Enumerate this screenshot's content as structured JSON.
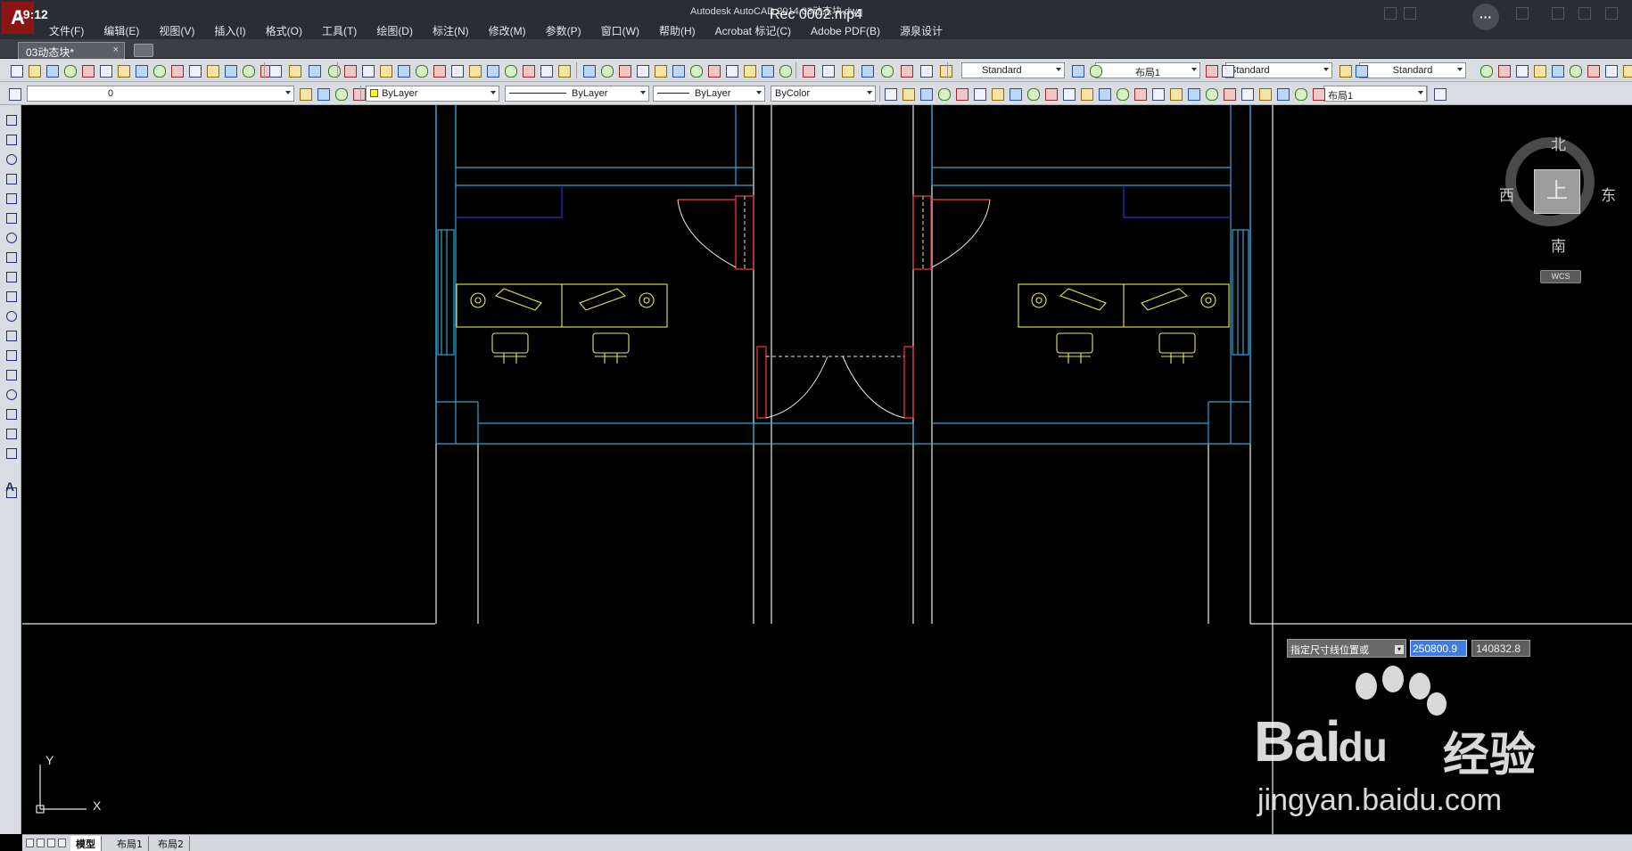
{
  "overlay": {
    "clock": "19:12",
    "video_title": "Rec 0002.mp4",
    "more_label": "···"
  },
  "window": {
    "title": "Autodesk AutoCAD 2014    03动态块.dwg",
    "app_logo": "A"
  },
  "menu": [
    "文件(F)",
    "编辑(E)",
    "视图(V)",
    "插入(I)",
    "格式(O)",
    "工具(T)",
    "绘图(D)",
    "标注(N)",
    "修改(M)",
    "参数(P)",
    "窗口(W)",
    "帮助(H)",
    "Acrobat 标记(C)",
    "Adobe PDF(B)",
    "源泉设计"
  ],
  "document_tab": {
    "label": "03动态块*",
    "close": "×"
  },
  "toolbar1": {
    "text_style": "Standard",
    "layout_select": "布局1",
    "table_style": "Standard",
    "mleader_style": "Standard"
  },
  "toolbar2": {
    "layer": "0",
    "color": "ByLayer",
    "linetype": "ByLayer",
    "lineweight": "ByLayer",
    "plotstyle": "ByColor",
    "dim_layout": "布局1"
  },
  "left_toolbar": {
    "text_tool": "A"
  },
  "viewcube": {
    "north": "北",
    "south": "南",
    "east": "东",
    "west": "西",
    "top": "上",
    "wcs": "WCS"
  },
  "dynamic_input": {
    "prompt": "指定尺寸线位置或",
    "dropdown": "▾",
    "value_x": "250800.9",
    "value_y": "140832.8"
  },
  "ucs": {
    "y": "Y",
    "x": "X"
  },
  "watermark": {
    "brand": "Bai",
    "brand2": "du",
    "cn": "经验",
    "url": "jingyan.baidu.com"
  },
  "layout_tabs": [
    "模型",
    "布局1",
    "布局2"
  ],
  "colors": {
    "wall": "#2aa8d8",
    "outline": "#e8e8e8",
    "furniture": "#e8e84a",
    "door": "#d83030",
    "navy": "#2a30c8"
  }
}
